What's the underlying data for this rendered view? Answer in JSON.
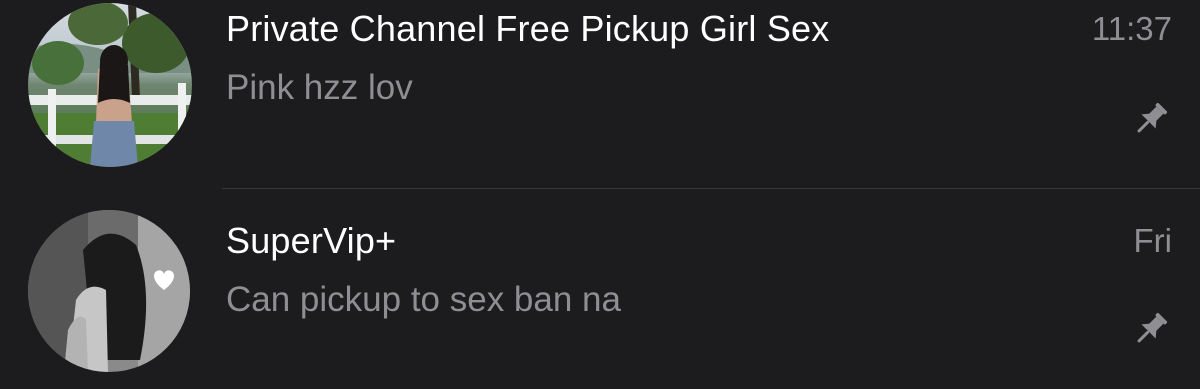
{
  "chats": [
    {
      "title": "Private Channel Free Pickup Girl Sex",
      "preview": "Pink hzz lov",
      "time": "11:37",
      "pinned": true,
      "avatar": "photo-woman-at-fence-outdoors"
    },
    {
      "title": "SuperVip+",
      "preview": "Can pickup to sex ban na",
      "time": "Fri",
      "pinned": true,
      "avatar": "bw-photo-woman-with-heart"
    }
  ],
  "colors": {
    "background": "#1c1c1e",
    "title": "#ffffff",
    "secondary_text": "#8e8e93",
    "separator": "#38383a"
  }
}
